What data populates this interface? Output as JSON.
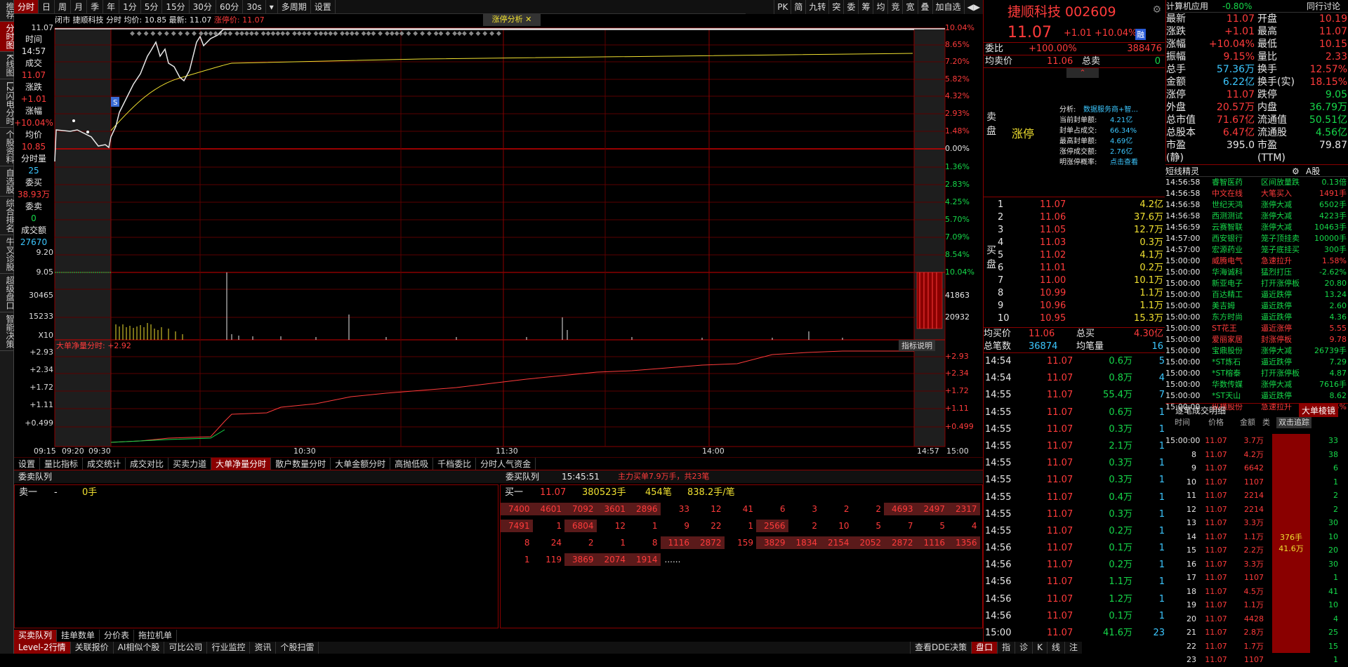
{
  "left_tabs": [
    "推荐",
    "分时图",
    "K线图",
    "L2闪电分时",
    "个股资料",
    "自选股",
    "综合排名",
    "牛叉诊股",
    "超级盘口",
    "智能决策"
  ],
  "toolbar": [
    "分时",
    "日",
    "周",
    "月",
    "季",
    "年",
    "1分",
    "5分",
    "15分",
    "30分",
    "60分",
    "30s",
    "▾",
    "多周期",
    "设置"
  ],
  "toolbar_right": [
    "PK",
    "简",
    "九转",
    "突",
    "委",
    "筹",
    "均",
    "竞",
    "宽",
    "叠",
    "加自选",
    "◀▶"
  ],
  "chart_info": {
    "status": "闭市",
    "name": "捷顺科技",
    "label": "分时 均价: 10.85 最新: 11.07",
    "limit": "涨停价: 11.07"
  },
  "zt_button": "涨停分析",
  "left_panel": [
    [
      "时间",
      "wht"
    ],
    [
      "14:57",
      "wht"
    ],
    [
      "成交",
      "wht"
    ],
    [
      "11.07",
      "red"
    ],
    [
      "涨跌",
      "wht"
    ],
    [
      "+1.01",
      "red"
    ],
    [
      "涨幅",
      "wht"
    ],
    [
      "+10.04%",
      "red"
    ],
    [
      "均价",
      "wht"
    ],
    [
      "10.85",
      "red"
    ],
    [
      "分时量",
      "wht"
    ],
    [
      "25",
      "cyn"
    ],
    [
      "委买",
      "wht"
    ],
    [
      "38.93万",
      "red"
    ],
    [
      "委卖",
      "wht"
    ],
    [
      "0",
      "grn"
    ],
    [
      "成交额",
      "wht"
    ],
    [
      "27670",
      "cyn"
    ]
  ],
  "axis_left": [
    {
      "t": "11.07",
      "c": "red"
    },
    {
      "t": "9.05",
      "c": "grn"
    },
    {
      "t": "30465",
      "c": "wht"
    },
    {
      "t": "15233",
      "c": "wht"
    },
    {
      "t": "X10",
      "c": "wht"
    },
    {
      "t": "+2.93",
      "c": "red"
    },
    {
      "t": "+2.34",
      "c": "red"
    },
    {
      "t": "+1.72",
      "c": "red"
    },
    {
      "t": "+1.11",
      "c": "red"
    },
    {
      "t": "+0.499",
      "c": "red"
    },
    {
      "t": "9.20",
      "c": "grn"
    }
  ],
  "axis_right": {
    "pct": [
      "10.04%",
      "8.65%",
      "7.20%",
      "5.82%",
      "4.32%",
      "2.93%",
      "1.48%",
      "0.00%",
      "1.36%",
      "2.83%",
      "4.25%",
      "5.70%",
      "7.09%",
      "8.54%",
      "10.04%"
    ],
    "vol": [
      "41863",
      "20932"
    ],
    "net": [
      "+2.93",
      "+2.34",
      "+1.72",
      "+1.11",
      "+0.499"
    ]
  },
  "x_labels": [
    "09:15",
    "09:20",
    "09:30",
    "10:30",
    "11:30",
    "14:00",
    "14:57",
    "15:00"
  ],
  "net_label": "大单净量分时: +2.92",
  "indicator_btn": "指标说明",
  "sub_tabs": [
    "设置",
    "量比指标",
    "成交统计",
    "成交对比",
    "买卖力道",
    "大单净量分时",
    "散户数量分时",
    "大单金额分时",
    "高抛低吸",
    "千档委比",
    "分时人气资金"
  ],
  "queue": {
    "sell_title": "委卖队列",
    "buy_title": "委买队列",
    "time": "15:45:51",
    "summary": "主力买单7.9万手，共23笔",
    "sell_row": [
      "卖一",
      "-",
      "0手"
    ],
    "buy_head": [
      "买一",
      "11.07",
      "380523手",
      "454笔",
      "838.2手/笔"
    ],
    "rows": [
      [
        "7400",
        "4601",
        "7092",
        "3601",
        "2896",
        "33",
        "12",
        "41",
        "6",
        "3",
        "2",
        "2",
        "4693",
        "2497",
        "2317"
      ],
      [
        "7491",
        "1",
        "6804",
        "12",
        "1",
        "9",
        "22",
        "1",
        "2566",
        "2",
        "10",
        "5",
        "7",
        "5",
        "4"
      ],
      [
        "8",
        "24",
        "2",
        "1",
        "8",
        "1116",
        "2872",
        "159",
        "3829",
        "1834",
        "2154",
        "2052",
        "2872",
        "1116",
        "1356"
      ],
      [
        "1",
        "119",
        "3869",
        "2074",
        "1914",
        "......"
      ]
    ],
    "hi": [
      [
        1,
        1,
        1,
        1,
        1,
        0,
        0,
        0,
        0,
        0,
        0,
        0,
        1,
        1,
        1
      ],
      [
        1,
        0,
        1,
        0,
        0,
        0,
        0,
        0,
        1,
        0,
        0,
        0,
        0,
        0,
        0
      ],
      [
        0,
        0,
        0,
        0,
        0,
        1,
        1,
        0,
        1,
        1,
        1,
        1,
        1,
        1,
        1
      ],
      [
        0,
        0,
        1,
        1,
        1,
        0
      ]
    ]
  },
  "bottom_tabs1": [
    "买卖队列",
    "挂单数单",
    "分价表",
    "拖拉机单"
  ],
  "bottom_tabs2": [
    "Level-2行情",
    "关联报价",
    "AI相似个股",
    "可比公司",
    "行业监控",
    "资讯",
    "个股扫雷"
  ],
  "bottom_right": [
    "查看DDE决策",
    "盘口",
    "指",
    "诊",
    "K",
    "线",
    "注"
  ],
  "quote": {
    "name": "捷顺科技 002609",
    "price": "11.07",
    "chg": "+1.01",
    "pct": "+10.04%",
    "badge": "融",
    "wb_label": "委比",
    "wb": "+100.00%",
    "wb_diff": "388476",
    "avg_label": "均卖价",
    "avg": "11.06",
    "zm_label": "总卖",
    "zm": "0",
    "limit_tag": "涨停",
    "analysis": [
      [
        "分析:",
        "数据服务商+智..."
      ],
      [
        "当前封单额:",
        "4.21亿"
      ],
      [
        "封单占成交:",
        "66.34%"
      ],
      [
        "最高封单额:",
        "4.69亿"
      ],
      [
        "涨停成交额:",
        "2.76亿"
      ],
      [
        "明涨停概率:",
        "点击查看"
      ]
    ],
    "sell_label": "卖盘",
    "buy_label": "买盘",
    "bids": [
      [
        "1",
        "11.07",
        "4.2亿"
      ],
      [
        "2",
        "11.06",
        "37.6万"
      ],
      [
        "3",
        "11.05",
        "12.7万"
      ],
      [
        "4",
        "11.03",
        "0.3万"
      ],
      [
        "5",
        "11.02",
        "4.1万"
      ],
      [
        "6",
        "11.01",
        "0.2万"
      ],
      [
        "7",
        "11.00",
        "10.1万"
      ],
      [
        "8",
        "10.99",
        "1.1万"
      ],
      [
        "9",
        "10.96",
        "1.1万"
      ],
      [
        "10",
        "10.95",
        "15.3万"
      ]
    ],
    "buy_avg": [
      "均买价",
      "11.06",
      "总买",
      "4.30亿"
    ],
    "total_ticks": [
      "总笔数",
      "36874",
      "均笔量",
      "16"
    ],
    "ticks": [
      [
        "14:54",
        "11.07",
        "0.6万",
        "5"
      ],
      [
        "14:54",
        "11.07",
        "0.8万",
        "4"
      ],
      [
        "14:55",
        "11.07",
        "55.4万",
        "7"
      ],
      [
        "14:55",
        "11.07",
        "0.6万",
        "1"
      ],
      [
        "14:55",
        "11.07",
        "0.3万",
        "1"
      ],
      [
        "14:55",
        "11.07",
        "2.1万",
        "1"
      ],
      [
        "14:55",
        "11.07",
        "0.3万",
        "1"
      ],
      [
        "14:55",
        "11.07",
        "0.3万",
        "1"
      ],
      [
        "14:55",
        "11.07",
        "0.4万",
        "1"
      ],
      [
        "14:55",
        "11.07",
        "0.3万",
        "1"
      ],
      [
        "14:55",
        "11.07",
        "0.2万",
        "1"
      ],
      [
        "14:56",
        "11.07",
        "0.1万",
        "1"
      ],
      [
        "14:56",
        "11.07",
        "0.2万",
        "1"
      ],
      [
        "14:56",
        "11.07",
        "1.1万",
        "1"
      ],
      [
        "14:56",
        "11.07",
        "1.2万",
        "1"
      ],
      [
        "14:56",
        "11.07",
        "0.1万",
        "1"
      ],
      [
        "15:00",
        "11.07",
        "41.6万",
        "23"
      ]
    ]
  },
  "stats_header": [
    "计算机应用",
    "-0.80%",
    "同行讨论"
  ],
  "stats": [
    [
      "最新",
      "11.07",
      "开盘",
      "10.19"
    ],
    [
      "涨跌",
      "+1.01",
      "最高",
      "11.07"
    ],
    [
      "涨幅",
      "+10.04%",
      "最低",
      "10.15"
    ],
    [
      "振幅",
      "9.15%",
      "量比",
      "2.33"
    ],
    [
      "总手",
      "57.36万",
      "换手",
      "12.57%"
    ],
    [
      "金额",
      "6.22亿",
      "换手(实)",
      "18.15%"
    ],
    [
      "涨停",
      "11.07",
      "跌停",
      "9.05"
    ],
    [
      "外盘",
      "20.57万",
      "内盘",
      "36.79万"
    ],
    [
      "总市值",
      "71.67亿",
      "流通值",
      "50.51亿"
    ],
    [
      "总股本",
      "6.47亿",
      "流通股",
      "4.56亿"
    ],
    [
      "市盈(静)",
      "395.0",
      "市盈(TTM)",
      "79.87"
    ]
  ],
  "stats_colors": [
    [
      "red",
      "red"
    ],
    [
      "red",
      "red"
    ],
    [
      "red",
      "red"
    ],
    [
      "red",
      "red"
    ],
    [
      "cyn",
      "red"
    ],
    [
      "cyn",
      "red"
    ],
    [
      "red",
      "grn"
    ],
    [
      "red",
      "grn"
    ],
    [
      "red",
      "grn"
    ],
    [
      "red",
      "grn"
    ],
    [
      "wht",
      "wht"
    ]
  ],
  "alerts_title": "短线精灵",
  "alerts_board": "A股",
  "alerts": [
    [
      "14:56:58",
      "睿智医药",
      "区间放量跌",
      "0.13倍",
      "grn"
    ],
    [
      "14:56:58",
      "中文在线",
      "大笔买入",
      "1491手",
      "red"
    ],
    [
      "14:56:58",
      "世纪天鸿",
      "涨停大减",
      "6502手",
      "grn"
    ],
    [
      "14:56:58",
      "西测测试",
      "涨停大减",
      "4223手",
      "grn"
    ],
    [
      "14:56:59",
      "云赛智联",
      "涨停大减",
      "10463手",
      "grn"
    ],
    [
      "14:57:00",
      "西安银行",
      "笼子顶挂卖",
      "10000手",
      "grn"
    ],
    [
      "14:57:00",
      "宏源药业",
      "笼子底挂买",
      "300手",
      "grn"
    ],
    [
      "15:00:00",
      "威腾电气",
      "急速拉升",
      "1.58%",
      "red"
    ],
    [
      "15:00:00",
      "华海诚科",
      "猛烈打压",
      "-2.62%",
      "grn"
    ],
    [
      "15:00:00",
      "新亚电子",
      "打开涨停板",
      "20.80",
      "grn"
    ],
    [
      "15:00:00",
      "百达精工",
      "逼近跌停",
      "13.24",
      "grn"
    ],
    [
      "15:00:00",
      "美吉姆",
      "逼近跌停",
      "2.60",
      "grn"
    ],
    [
      "15:00:00",
      "东方时尚",
      "逼近跌停",
      "4.36",
      "grn"
    ],
    [
      "15:00:00",
      "ST花王",
      "逼近涨停",
      "5.55",
      "red"
    ],
    [
      "15:00:00",
      "爱丽家居",
      "封涨停板",
      "9.78",
      "red"
    ],
    [
      "15:00:00",
      "宝鼎股份",
      "涨停大减",
      "26739手",
      "grn"
    ],
    [
      "15:00:00",
      "*ST炼石",
      "逼近跌停",
      "7.29",
      "grn"
    ],
    [
      "15:00:00",
      "*ST榕泰",
      "打开涨停板",
      "4.87",
      "grn"
    ],
    [
      "15:00:00",
      "华数传媒",
      "涨停大减",
      "7616手",
      "grn"
    ],
    [
      "15:00:00",
      "*ST天山",
      "逼近跌停",
      "8.62",
      "grn"
    ],
    [
      "15:00:00",
      "纵横股份",
      "急速拉升",
      "1.55%",
      "red"
    ]
  ],
  "tick_title": "逐笔成交明细",
  "tick_btn": "大单棱镜",
  "tick_cols": [
    "时间",
    "价格",
    "金额",
    "类"
  ],
  "tick_btn2": "双击追踪",
  "tick_rows": [
    [
      "15:00:00",
      "11.07",
      "3.7万",
      "33"
    ],
    [
      "8",
      "11.07",
      "4.2万",
      "38"
    ],
    [
      "9",
      "11.07",
      "6642",
      "6"
    ],
    [
      "10",
      "11.07",
      "1107",
      "1"
    ],
    [
      "11",
      "11.07",
      "2214",
      "2"
    ],
    [
      "12",
      "11.07",
      "2214",
      "2"
    ],
    [
      "13",
      "11.07",
      "3.3万",
      "30"
    ],
    [
      "14",
      "11.07",
      "1.1万",
      "10"
    ],
    [
      "15",
      "11.07",
      "2.2万",
      "20"
    ],
    [
      "16",
      "11.07",
      "3.3万",
      "30"
    ],
    [
      "17",
      "11.07",
      "1107",
      "1"
    ],
    [
      "18",
      "11.07",
      "4.5万",
      "41"
    ],
    [
      "19",
      "11.07",
      "1.1万",
      "10"
    ],
    [
      "20",
      "11.07",
      "4428",
      "4"
    ],
    [
      "21",
      "11.07",
      "2.8万",
      "25"
    ],
    [
      "22",
      "11.07",
      "1.7万",
      "15"
    ],
    [
      "23",
      "11.07",
      "1107",
      "1"
    ]
  ],
  "big_order": [
    "376手",
    "41.6万"
  ]
}
